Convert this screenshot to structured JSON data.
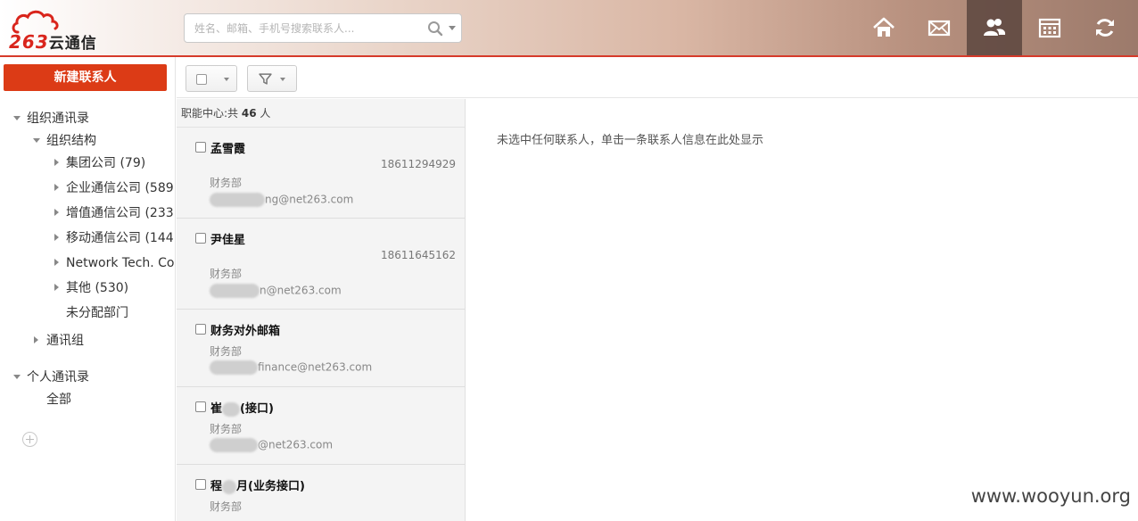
{
  "header": {
    "brand_number": "263",
    "brand_name": "云通信",
    "search": {
      "placeholder": "姓名、邮箱、手机号搜索联系人..."
    },
    "nav": [
      {
        "icon": "home-icon",
        "active": false
      },
      {
        "icon": "mail-icon",
        "active": false
      },
      {
        "icon": "contacts-icon",
        "active": true
      },
      {
        "icon": "calendar-icon",
        "active": false
      },
      {
        "icon": "sync-icon",
        "active": false
      }
    ]
  },
  "sidebar": {
    "new_contact_label": "新建联系人",
    "org_directory": "组织通讯录",
    "org_structure": "组织结构",
    "items": [
      {
        "label": "集团公司 (79)"
      },
      {
        "label": "企业通信公司 (589"
      },
      {
        "label": "增值通信公司 (233"
      },
      {
        "label": "移动通信公司 (144"
      },
      {
        "label": "Network Tech. Co"
      },
      {
        "label": "其他 (530)"
      },
      {
        "label": "未分配部门"
      }
    ],
    "groups": "通讯组",
    "personal_directory": "个人通讯录",
    "all": "全部"
  },
  "list": {
    "header_prefix": "职能中心:共",
    "count": "46",
    "header_suffix": "人",
    "contacts": [
      {
        "name": "孟雪霞",
        "phone": "18611294929",
        "dept": "财务部",
        "email": "ng@net263.com"
      },
      {
        "name": "尹佳星",
        "phone": "18611645162",
        "dept": "财务部",
        "email": "n@net263.com"
      },
      {
        "name": "财务对外邮箱",
        "phone": "",
        "dept": "财务部",
        "email": "finance@net263.com"
      },
      {
        "name_prefix": "崔",
        "name": "(接口)",
        "phone": "",
        "dept": "财务部",
        "email": "@net263.com"
      },
      {
        "name_prefix": "程",
        "name": "月(业务接口)",
        "phone": "",
        "dept": "财务部",
        "email": ""
      }
    ]
  },
  "detail": {
    "empty_message": "未选中任何联系人，单击一条联系人信息在此处显示"
  },
  "watermark": "www.wooyun.org"
}
